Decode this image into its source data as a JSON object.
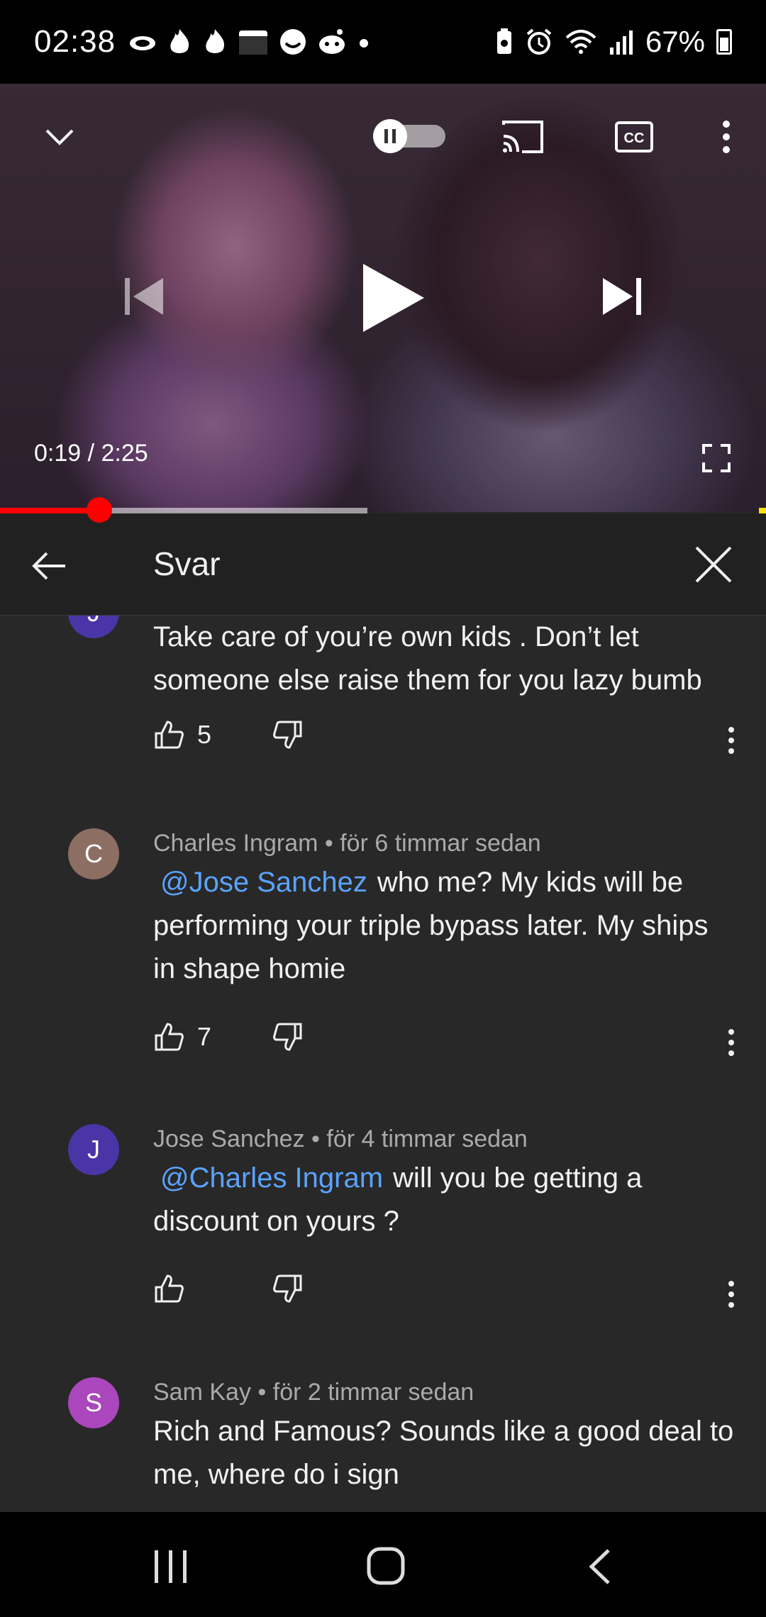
{
  "status_bar": {
    "time": "02:38",
    "notification_icons": [
      "cloud-icon",
      "flame-icon",
      "flame-icon",
      "clapper-icon",
      "smiley-icon",
      "reddit-icon",
      "dot-icon"
    ],
    "system_icons": [
      "battery-saver-icon",
      "alarm-icon",
      "wifi-icon",
      "signal-icon"
    ],
    "battery": "67%"
  },
  "player": {
    "time_display": "0:19 / 2:25",
    "progress_fraction": 0.13,
    "buffer_fraction": 0.48,
    "autoplay_state": "paused"
  },
  "replies_header": {
    "title": "Svar"
  },
  "comments": [
    {
      "avatar_letter": "J",
      "avatar_color": "#4a35a6",
      "author": "",
      "time": "",
      "mention": "",
      "text": "Take care of you’re own kids . Don’t let someone else raise them for you lazy bumb",
      "likes": "5"
    },
    {
      "avatar_letter": "C",
      "avatar_color": "#8d6e63",
      "author": "Charles Ingram",
      "time": "för 6 timmar sedan",
      "mention": "@Jose Sanchez",
      "text": "who me? My kids will be performing your triple bypass later.  My ships in shape homie",
      "likes": "7"
    },
    {
      "avatar_letter": "J",
      "avatar_color": "#4a35a6",
      "author": "Jose Sanchez",
      "time": "för 4 timmar sedan",
      "mention": "@Charles Ingram",
      "text": "will you be getting a discount on yours ?",
      "likes": ""
    },
    {
      "avatar_letter": "S",
      "avatar_color": "#ab47bc",
      "author": "Sam Kay",
      "time": "för 2 timmar sedan",
      "mention": "",
      "text": "Rich and Famous? Sounds like a good deal to me, where do i sign",
      "likes": ""
    }
  ],
  "colors": {
    "background": "#282828",
    "mention": "#5aa3ff",
    "progress": "#ff0000"
  }
}
